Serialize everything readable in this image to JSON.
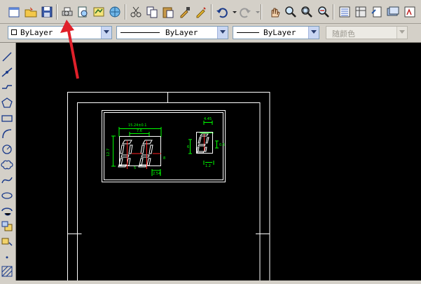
{
  "toolbar": {
    "buttons": [
      "new-icon",
      "open-icon",
      "save-icon",
      "print-icon",
      "print-preview-icon",
      "publish-icon",
      "3d-publish-icon",
      "cut-icon",
      "copy-icon",
      "paste-icon",
      "match-properties-icon",
      "block-editor-icon",
      "undo-icon",
      "redo-icon",
      "pan-icon",
      "zoom-realtime-icon",
      "zoom-window-icon",
      "zoom-previous-icon",
      "properties-icon",
      "design-center-icon",
      "tool-palettes-icon",
      "sheet-set-icon",
      "markup-icon",
      "calculator-icon"
    ]
  },
  "properties": {
    "layer_value": "ByLayer",
    "linetype_value": "ByLayer",
    "lineweight_value": "ByLayer",
    "plotstyle_value": "随颜色"
  },
  "draw_toolbar": {
    "tools": [
      "line-icon",
      "construction-line-icon",
      "polyline-icon",
      "polygon-icon",
      "rectangle-icon",
      "arc-icon",
      "circle-icon",
      "revision-cloud-icon",
      "spline-icon",
      "ellipse-icon",
      "ellipse-arc-icon",
      "insert-block-icon",
      "make-block-icon",
      "point-icon",
      "hatch-icon"
    ]
  },
  "drawing": {
    "dim_labels": [
      "15.24±0.1",
      "7.6",
      "12.7",
      "4.45",
      "2.54",
      "1.2",
      "0.5",
      "6",
      "8",
      "5"
    ],
    "colors": {
      "dims": "#00ff00",
      "outline": "#ffffff",
      "centerlines": "#ff0000"
    }
  },
  "colors": {
    "canvas": "#000000",
    "chrome": "#d4d0c8",
    "annotation_arrow": "#e0202a"
  }
}
